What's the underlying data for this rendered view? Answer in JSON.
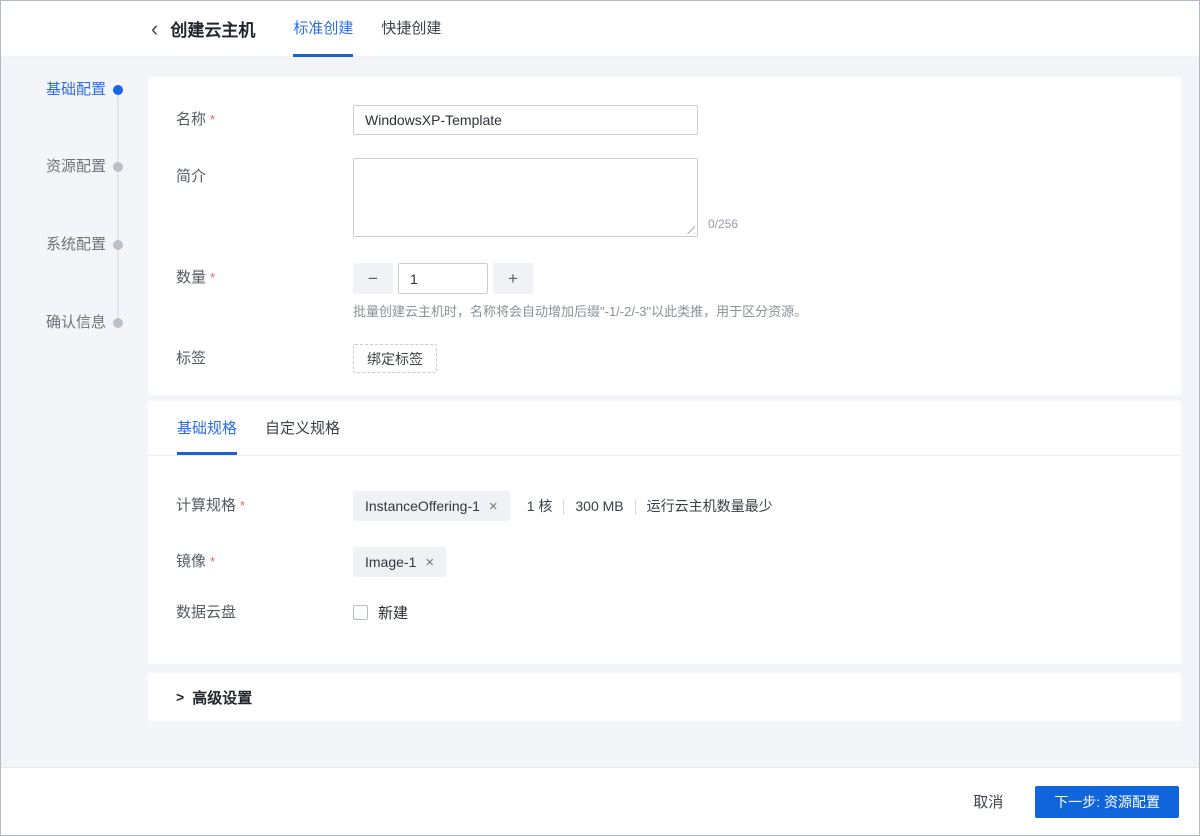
{
  "ui": {
    "required_mark": "*",
    "back_icon": "‹",
    "chevron_right": ">",
    "minus": "−",
    "plus": "+"
  },
  "header": {
    "title": "创建云主机",
    "tabs": [
      {
        "label": "标准创建",
        "active": true
      },
      {
        "label": "快捷创建",
        "active": false
      }
    ]
  },
  "steps": [
    {
      "label": "基础配置",
      "active": true
    },
    {
      "label": "资源配置",
      "active": false
    },
    {
      "label": "系统配置",
      "active": false
    },
    {
      "label": "确认信息",
      "active": false
    }
  ],
  "basic": {
    "name_label": "名称",
    "name_value": "WindowsXP-Template",
    "desc_label": "简介",
    "desc_value": "",
    "desc_counter": "0/256",
    "qty_label": "数量",
    "qty_value": "1",
    "qty_hint": "批量创建云主机时，名称将会自动增加后缀\"-1/-2/-3\"以此类推，用于区分资源。",
    "tag_label": "标签",
    "tag_button": "绑定标签"
  },
  "spec": {
    "tabs": [
      {
        "label": "基础规格",
        "active": true
      },
      {
        "label": "自定义规格",
        "active": false
      }
    ],
    "offering_label": "计算规格",
    "offering_chip": "InstanceOffering-1",
    "chip_close": "×",
    "offering_info": [
      "1 核",
      "300 MB",
      "运行云主机数量最少"
    ],
    "image_label": "镜像",
    "image_chip": "Image-1",
    "disk_label": "数据云盘",
    "disk_option": "新建",
    "disk_checked": false
  },
  "advanced_label": "高级设置",
  "footer": {
    "cancel": "取消",
    "next": "下一步: 资源配置"
  },
  "colors": {
    "accent_blue": "#2d6ee6",
    "button_blue": "#1064dc",
    "required_red": "#f0615c",
    "page_bg": "#f4f5f8"
  }
}
